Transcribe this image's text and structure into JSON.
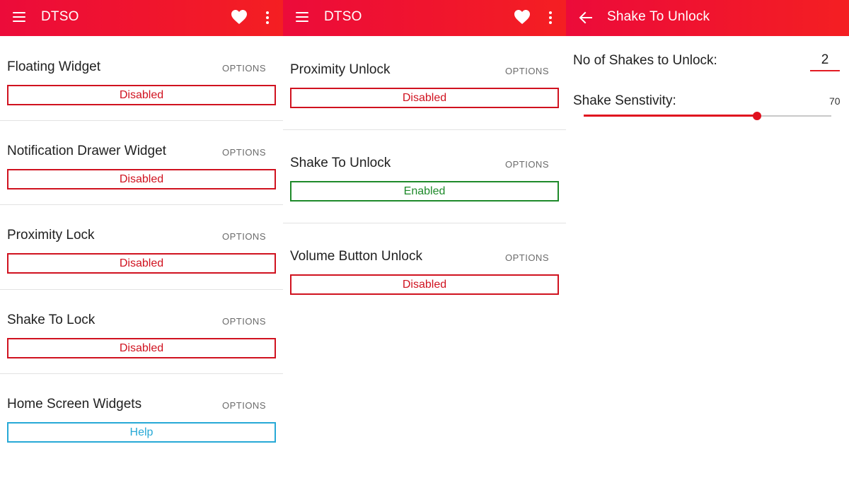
{
  "colors": {
    "appbar_start": "#ec0b3a",
    "appbar_end": "#f41f22",
    "disabled": "#d0121f",
    "enabled": "#1e8a2a",
    "help": "#27a9d6",
    "accent": "#e0101e"
  },
  "panels": [
    {
      "appbar": {
        "title": "DTSO",
        "nav_icon": "hamburger-menu-icon",
        "actions": [
          "heart-icon",
          "more-vert-icon"
        ]
      },
      "features": [
        {
          "name": "Floating Widget",
          "options_label": "OPTIONS",
          "status": "Disabled",
          "state": "disabled"
        },
        {
          "name": "Notification Drawer Widget",
          "options_label": "OPTIONS",
          "status": "Disabled",
          "state": "disabled"
        },
        {
          "name": "Proximity Lock",
          "options_label": "OPTIONS",
          "status": "Disabled",
          "state": "disabled"
        },
        {
          "name": "Shake To Lock",
          "options_label": "OPTIONS",
          "status": "Disabled",
          "state": "disabled"
        },
        {
          "name": "Home Screen Widgets",
          "options_label": "OPTIONS",
          "status": "Help",
          "state": "help"
        }
      ]
    },
    {
      "appbar": {
        "title": "DTSO",
        "nav_icon": "hamburger-menu-icon",
        "actions": [
          "heart-icon",
          "more-vert-icon"
        ]
      },
      "features": [
        {
          "name": "Proximity Unlock",
          "options_label": "OPTIONS",
          "status": "Disabled",
          "state": "disabled"
        },
        {
          "name": "Shake To Unlock",
          "options_label": "OPTIONS",
          "status": "Enabled",
          "state": "enabled"
        },
        {
          "name": "Volume Button Unlock",
          "options_label": "OPTIONS",
          "status": "Disabled",
          "state": "disabled"
        }
      ]
    },
    {
      "appbar": {
        "title": "Shake To Unlock",
        "nav_icon": "back-arrow-icon"
      },
      "settings": {
        "shakes_label": "No of Shakes to Unlock:",
        "shakes_value": "2",
        "sensitivity_label": "Shake Senstivity:",
        "sensitivity_value": "70",
        "sensitivity_fraction": 0.7
      }
    }
  ]
}
